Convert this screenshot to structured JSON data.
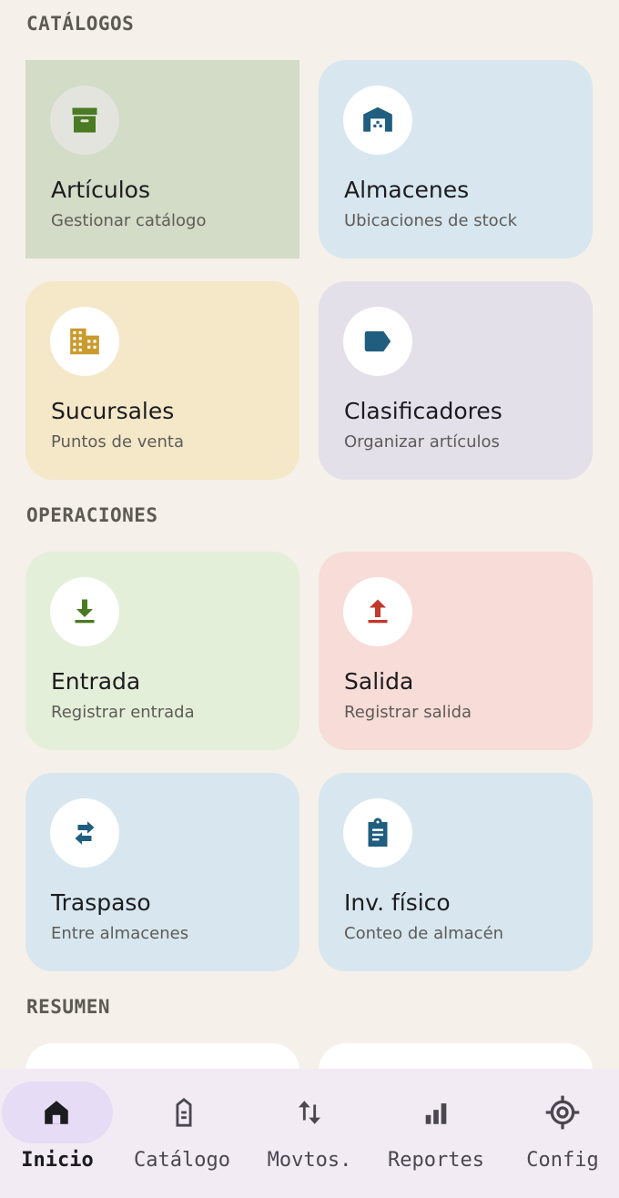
{
  "sections": {
    "catalogos": "CATÁLOGOS",
    "operaciones": "OPERACIONES",
    "resumen": "RESUMEN"
  },
  "catalog_cards": [
    {
      "title": "Artículos",
      "subtitle": "Gestionar catálogo",
      "icon": "archive-box-icon",
      "bg": "#d2dcc6",
      "icon_color": "#4a7a22"
    },
    {
      "title": "Almacenes",
      "subtitle": "Ubicaciones de stock",
      "icon": "warehouse-icon",
      "bg": "#d8e7ef",
      "icon_color": "#1f5e7e"
    },
    {
      "title": "Sucursales",
      "subtitle": "Puntos de venta",
      "icon": "building-icon",
      "bg": "#f4e8c9",
      "icon_color": "#c99a2e"
    },
    {
      "title": "Clasificadores",
      "subtitle": "Organizar artículos",
      "icon": "label-tag-icon",
      "bg": "#e3e0ea",
      "icon_color": "#1f5e7e"
    }
  ],
  "operation_cards": [
    {
      "title": "Entrada",
      "subtitle": "Registrar entrada",
      "icon": "download-icon",
      "bg": "#e4efd9",
      "icon_color": "#4a7a22"
    },
    {
      "title": "Salida",
      "subtitle": "Registrar salida",
      "icon": "upload-icon",
      "bg": "#f7dcd7",
      "icon_color": "#c0392b"
    },
    {
      "title": "Traspaso",
      "subtitle": "Entre almacenes",
      "icon": "swap-arrows-icon",
      "bg": "#d8e7ef",
      "icon_color": "#1f5e7e"
    },
    {
      "title": "Inv. físico",
      "subtitle": "Conteo de almacén",
      "icon": "clipboard-icon",
      "bg": "#d8e7ef",
      "icon_color": "#1f5e7e"
    }
  ],
  "bottom_nav": [
    {
      "label": "Inicio",
      "icon": "home-icon",
      "active": true
    },
    {
      "label": "Catálogo",
      "icon": "catalog-icon",
      "active": false
    },
    {
      "label": "Movtos.",
      "icon": "up-down-arrows-icon",
      "active": false
    },
    {
      "label": "Reportes",
      "icon": "bar-chart-icon",
      "active": false
    },
    {
      "label": "Config",
      "icon": "target-icon",
      "active": false
    }
  ],
  "colors": {
    "background": "#f5f0e9",
    "nav_background": "#f2ebf4",
    "nav_active_pill": "#e6dcf5"
  }
}
